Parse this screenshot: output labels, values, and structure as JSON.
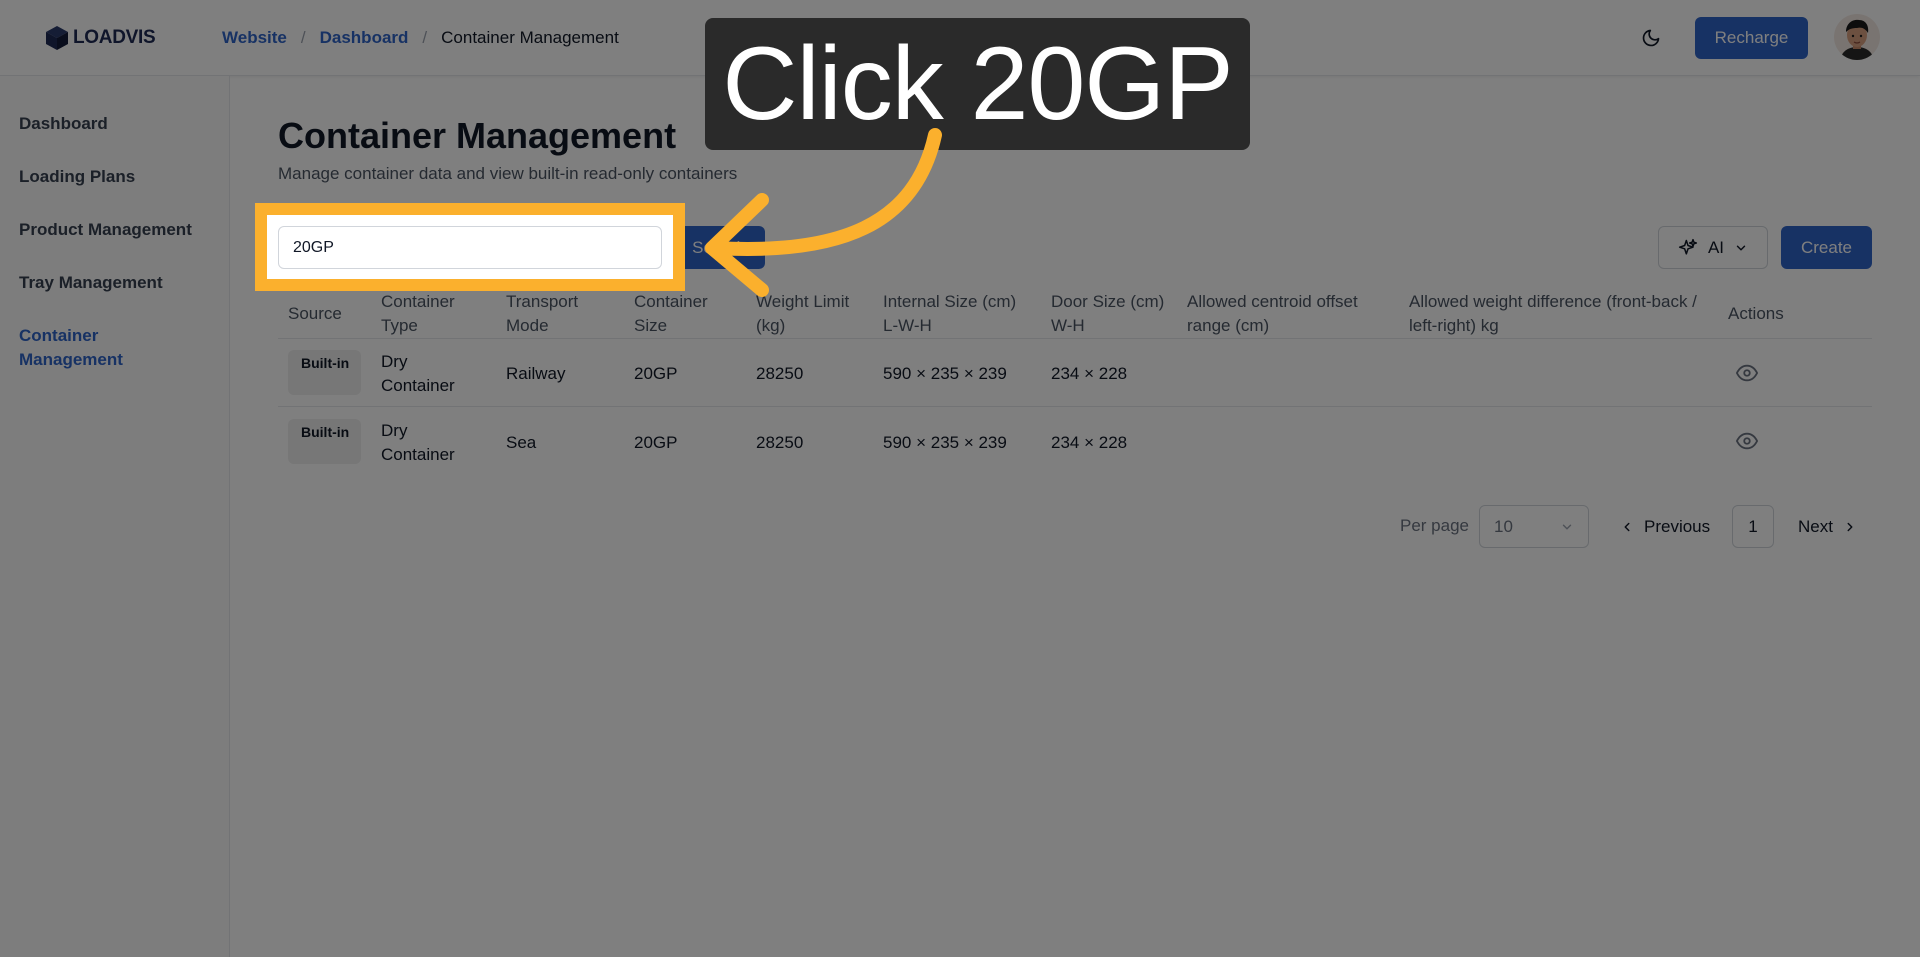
{
  "app": {
    "logo_text": "LOADVIS"
  },
  "breadcrumb": {
    "items": [
      "Website",
      "Dashboard"
    ],
    "current": "Container Management"
  },
  "header": {
    "recharge_label": "Recharge"
  },
  "sidebar": {
    "items": [
      {
        "label": "Dashboard",
        "active": false
      },
      {
        "label": "Loading Plans",
        "active": false
      },
      {
        "label": "Product Management",
        "active": false
      },
      {
        "label": "Tray Management",
        "active": false
      },
      {
        "label": "Container Management",
        "active": true
      }
    ]
  },
  "page": {
    "title": "Container Management",
    "subtitle": "Manage container data and view built-in read-only containers"
  },
  "search": {
    "value": "20GP",
    "button_label": "Search"
  },
  "toolbar": {
    "ai_label": "AI",
    "create_label": "Create"
  },
  "table": {
    "headers": [
      "Source",
      "Container Type",
      "Transport Mode",
      "Container Size",
      "Weight Limit (kg)",
      "Internal Size (cm) L-W-H",
      "Door Size (cm) W-H",
      "Allowed centroid offset range (cm)",
      "Allowed weight difference (front-back / left-right) kg",
      "Actions"
    ],
    "rows": [
      {
        "source": "Built-in",
        "type": "Dry Container",
        "mode": "Railway",
        "size": "20GP",
        "weight": "28250",
        "internal": "590 × 235 × 239",
        "door": "234 × 228",
        "centroid": "",
        "weight_diff": ""
      },
      {
        "source": "Built-in",
        "type": "Dry Container",
        "mode": "Sea",
        "size": "20GP",
        "weight": "28250",
        "internal": "590 × 235 × 239",
        "door": "234 × 228",
        "centroid": "",
        "weight_diff": ""
      }
    ]
  },
  "pagination": {
    "per_page_label": "Per page",
    "per_page_value": "10",
    "previous_label": "Previous",
    "current_page": "1",
    "next_label": "Next"
  },
  "overlay": {
    "callout_text": "Click 20GP"
  },
  "colors": {
    "accent": "#2f64c9",
    "highlight": "#fbb02d",
    "callout_bg": "#2a2a2a"
  }
}
